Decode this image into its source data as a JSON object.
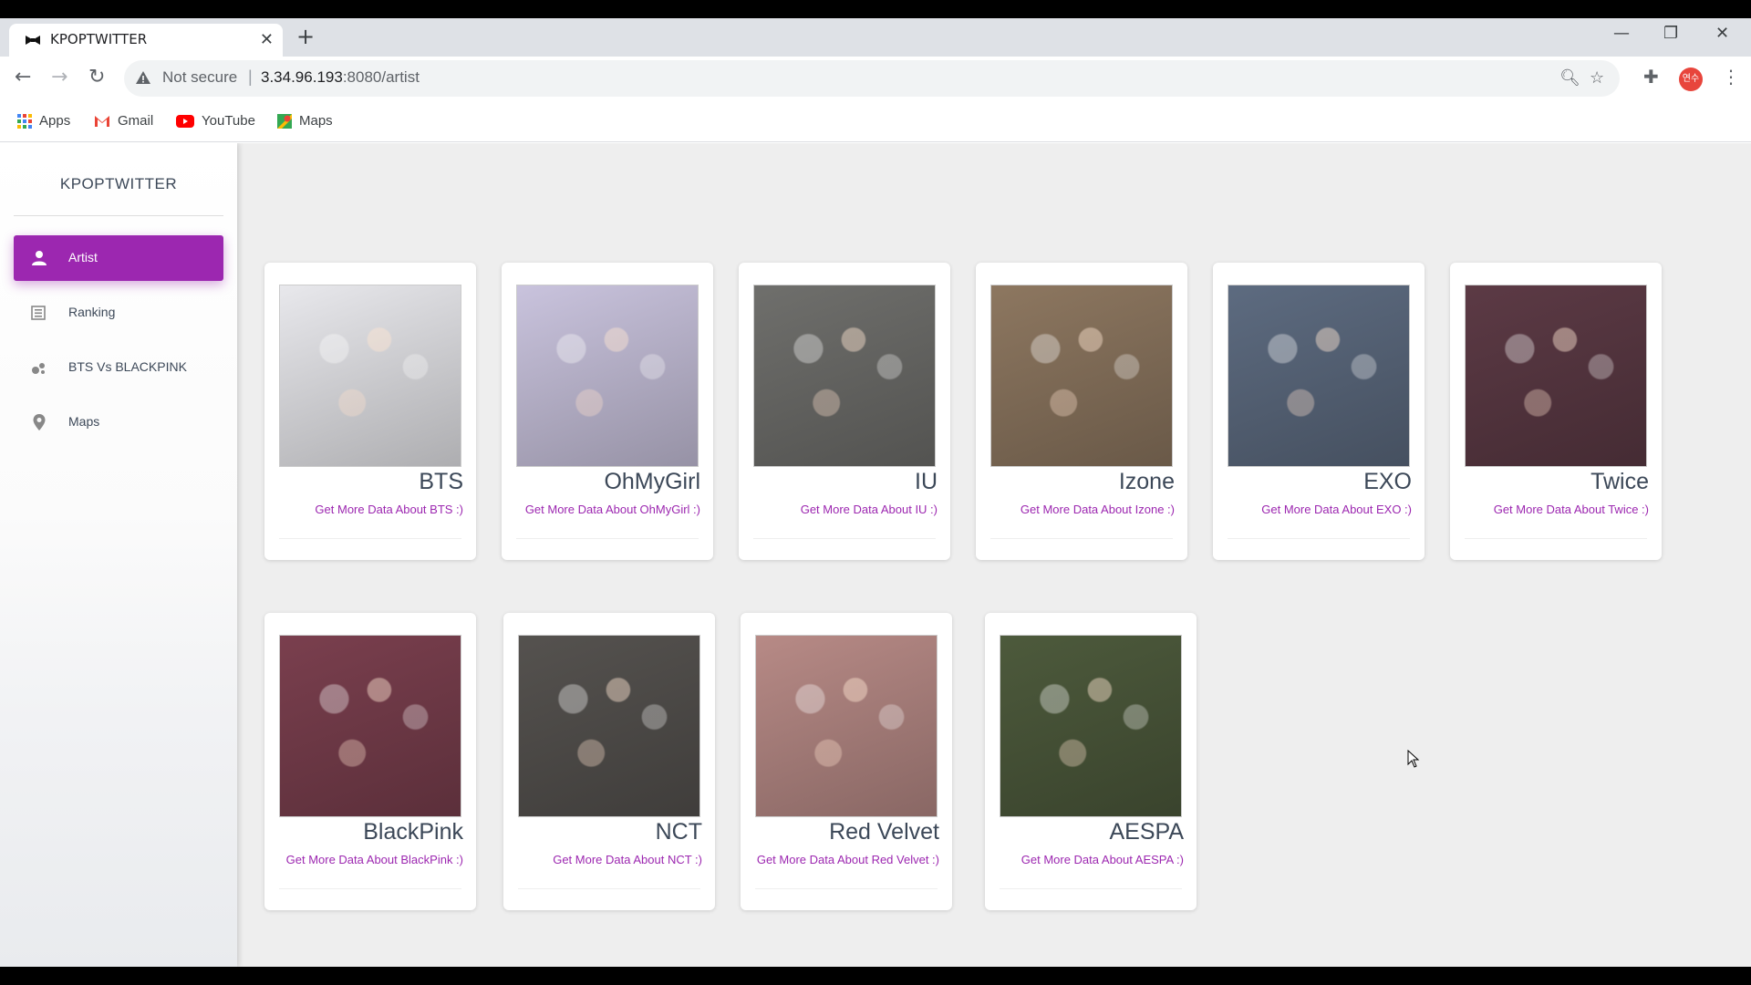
{
  "browser": {
    "tab_title": "KPOPTWITTER",
    "tab_close": "✕",
    "new_tab": "+",
    "minimize": "—",
    "restore": "❐",
    "close": "✕",
    "not_secure": "Not secure",
    "url_host": "3.34.96.193",
    "url_path": ":8080/artist",
    "profile_initials": "연수",
    "bookmarks": {
      "apps": "Apps",
      "gmail": "Gmail",
      "youtube": "YouTube",
      "maps": "Maps"
    }
  },
  "sidebar": {
    "brand": "KPOPTWITTER",
    "items": [
      {
        "label": "Artist",
        "icon": "person-icon"
      },
      {
        "label": "Ranking",
        "icon": "list-icon"
      },
      {
        "label": "BTS Vs BLACKPINK",
        "icon": "bubble-chart-icon"
      },
      {
        "label": "Maps",
        "icon": "location-pin-icon"
      }
    ]
  },
  "artists": [
    {
      "name": "BTS",
      "link": "Get More Data About BTS :)",
      "tone": "#e8e8ec"
    },
    {
      "name": "OhMyGirl",
      "link": "Get More Data About OhMyGirl :)",
      "tone": "#c9c3dd"
    },
    {
      "name": "IU",
      "link": "Get More Data About IU :)",
      "tone": "#6f6f6c"
    },
    {
      "name": "Izone",
      "link": "Get More Data About Izone :)",
      "tone": "#8d7760"
    },
    {
      "name": "EXO",
      "link": "Get More Data About EXO :)",
      "tone": "#5d6b80"
    },
    {
      "name": "Twice",
      "link": "Get More Data About Twice :)",
      "tone": "#5c3a45"
    },
    {
      "name": "BlackPink",
      "link": "Get More Data About BlackPink :)",
      "tone": "#7a3f4e"
    },
    {
      "name": "NCT",
      "link": "Get More Data About NCT :)",
      "tone": "#55524f"
    },
    {
      "name": "Red Velvet",
      "link": "Get More Data About Red Velvet :)",
      "tone": "#b78a86"
    },
    {
      "name": "AESPA",
      "link": "Get More Data About AESPA :)",
      "tone": "#4d5a3c"
    }
  ]
}
